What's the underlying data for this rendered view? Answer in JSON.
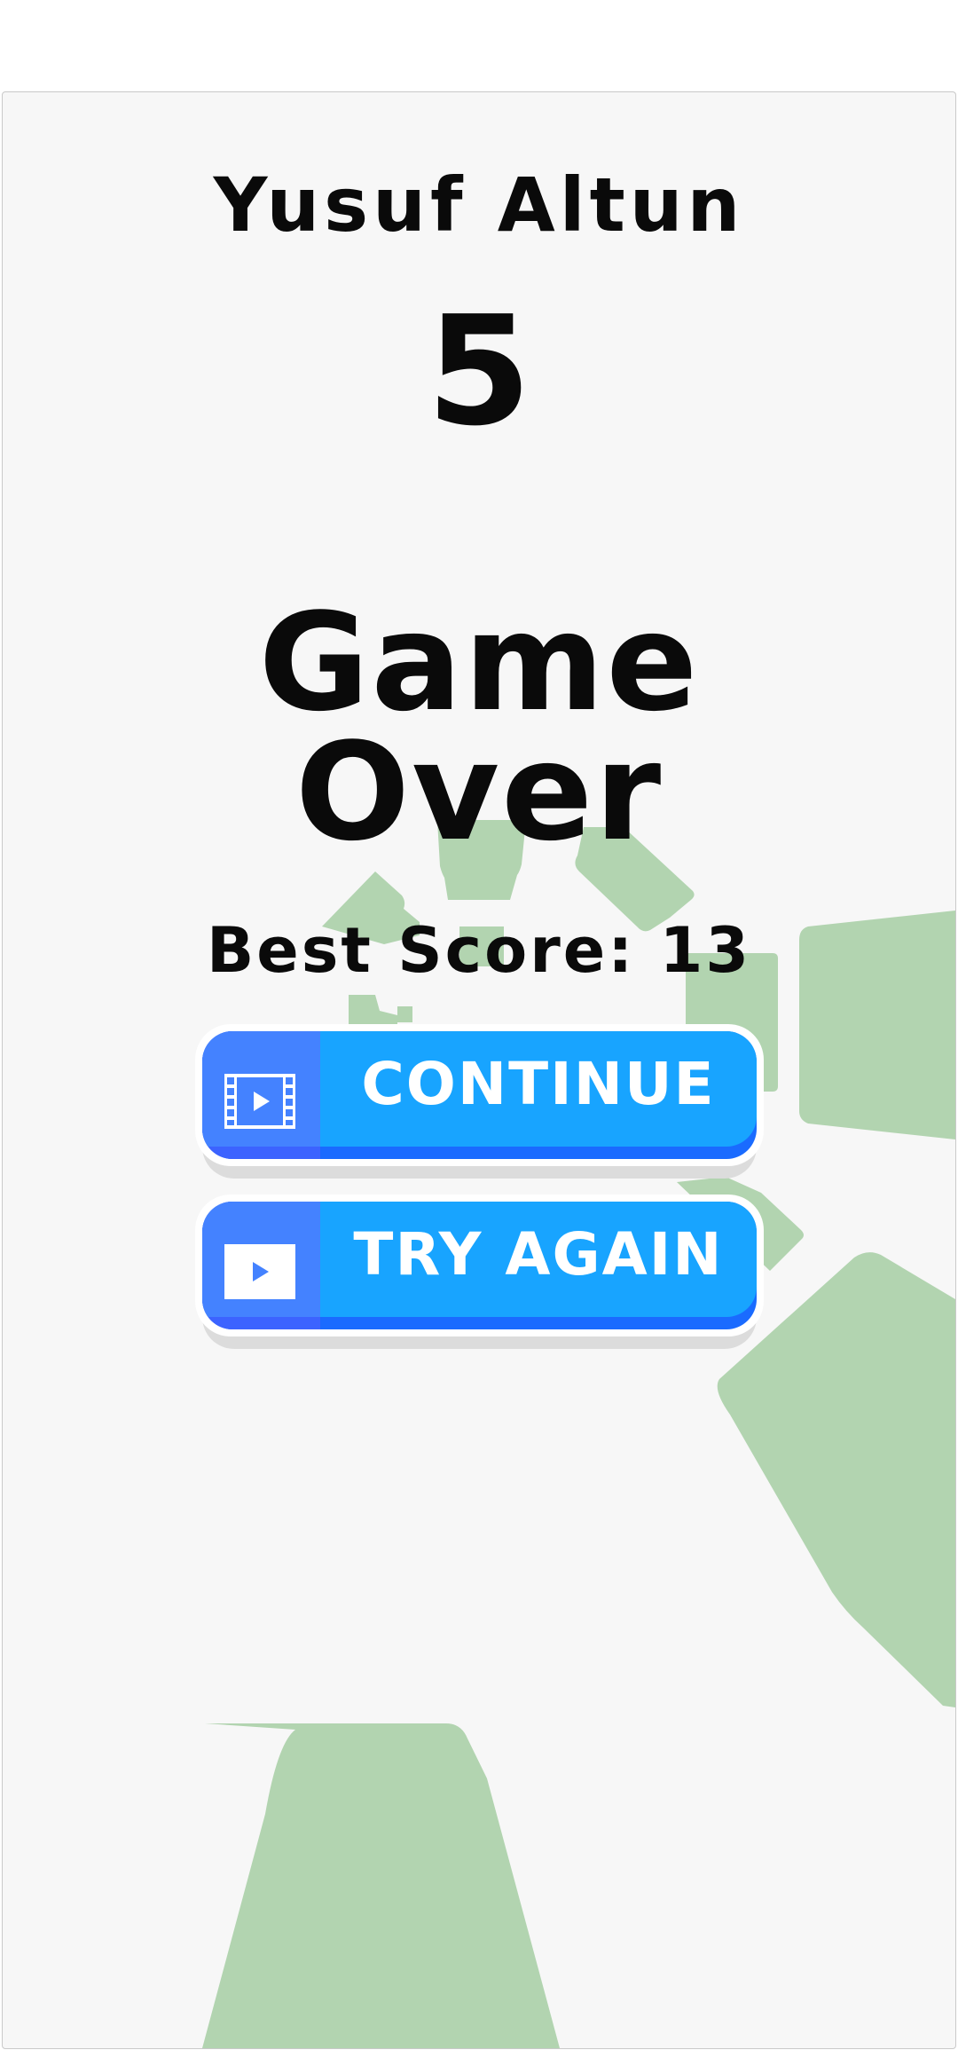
{
  "player": {
    "name": "Yusuf Altun"
  },
  "game": {
    "current_score": "5",
    "status_line_1": "Game",
    "status_line_2": "Over",
    "best_score_text": "Best Score: 13"
  },
  "buttons": {
    "continue": {
      "label": "CONTINUE",
      "icon": "film-strip-play-icon"
    },
    "try_again": {
      "label": "TRY AGAIN",
      "icon": "play-icon"
    }
  },
  "colors": {
    "background": "#f7f7f7",
    "shape_green": "#b2d4b0",
    "text": "#0a0a0a",
    "button_blue": "#18a4ff",
    "button_dark": "#1a6bff",
    "button_icon_zone": "#4482ff"
  }
}
